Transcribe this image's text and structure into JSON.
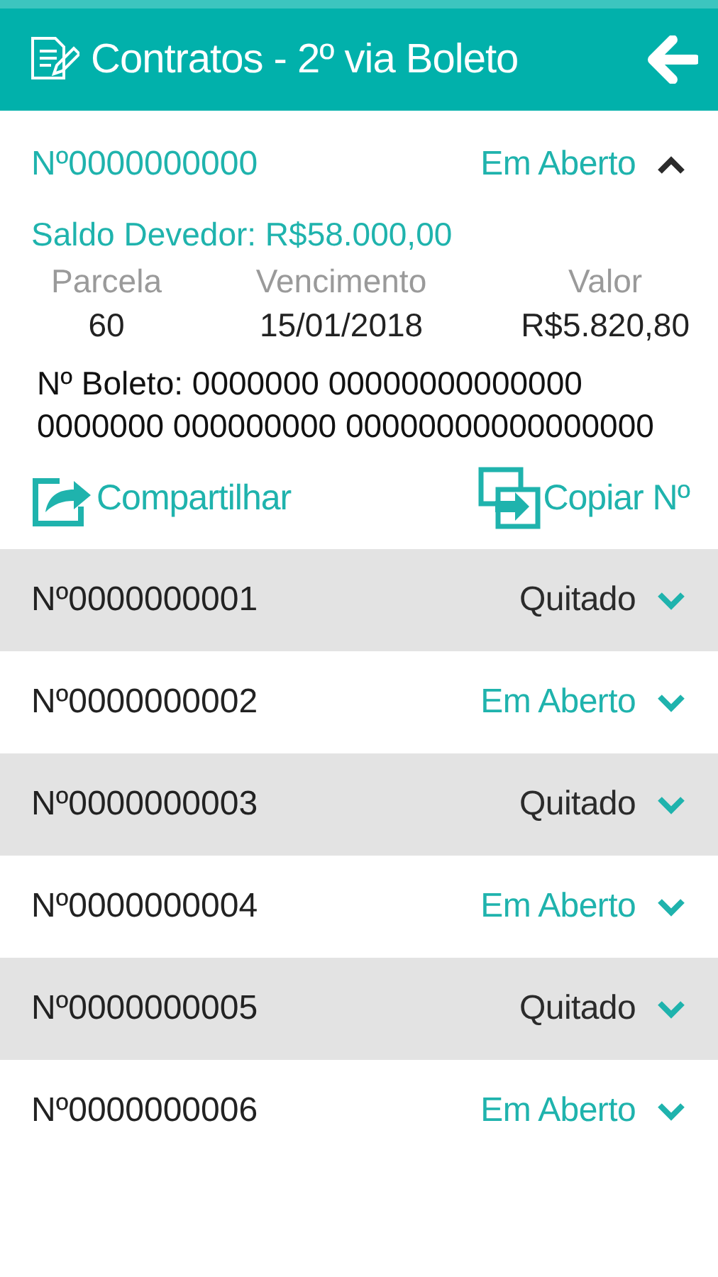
{
  "header": {
    "title": "Contratos - 2º via Boleto"
  },
  "contracts": [
    {
      "number": "Nº0000000000",
      "status": "Em Aberto",
      "kind": "open",
      "expanded": true,
      "details": {
        "balance": "Saldo Devedor: R$58.000,00",
        "columns": [
          {
            "label": "Parcela",
            "value": "60"
          },
          {
            "label": "Vencimento",
            "value": "15/01/2018"
          },
          {
            "label": "Valor",
            "value": "R$5.820,80"
          }
        ],
        "boleto_label": "Nº Boleto:",
        "boleto_number": "0000000 00000000000000 0000000 000000000 00000000000000000",
        "actions": [
          {
            "kind": "share",
            "label": "Compartilhar"
          },
          {
            "kind": "copy",
            "label": "Copiar Nº"
          }
        ]
      }
    },
    {
      "number": "Nº0000000001",
      "status": "Quitado",
      "kind": "paid",
      "expanded": false
    },
    {
      "number": "Nº0000000002",
      "status": "Em Aberto",
      "kind": "open",
      "expanded": false
    },
    {
      "number": "Nº0000000003",
      "status": "Quitado",
      "kind": "paid",
      "expanded": false
    },
    {
      "number": "Nº0000000004",
      "status": "Em Aberto",
      "kind": "open",
      "expanded": false
    },
    {
      "number": "Nº0000000005",
      "status": "Quitado",
      "kind": "paid",
      "expanded": false
    },
    {
      "number": "Nº0000000006",
      "status": "Em Aberto",
      "kind": "open",
      "expanded": false
    }
  ]
}
